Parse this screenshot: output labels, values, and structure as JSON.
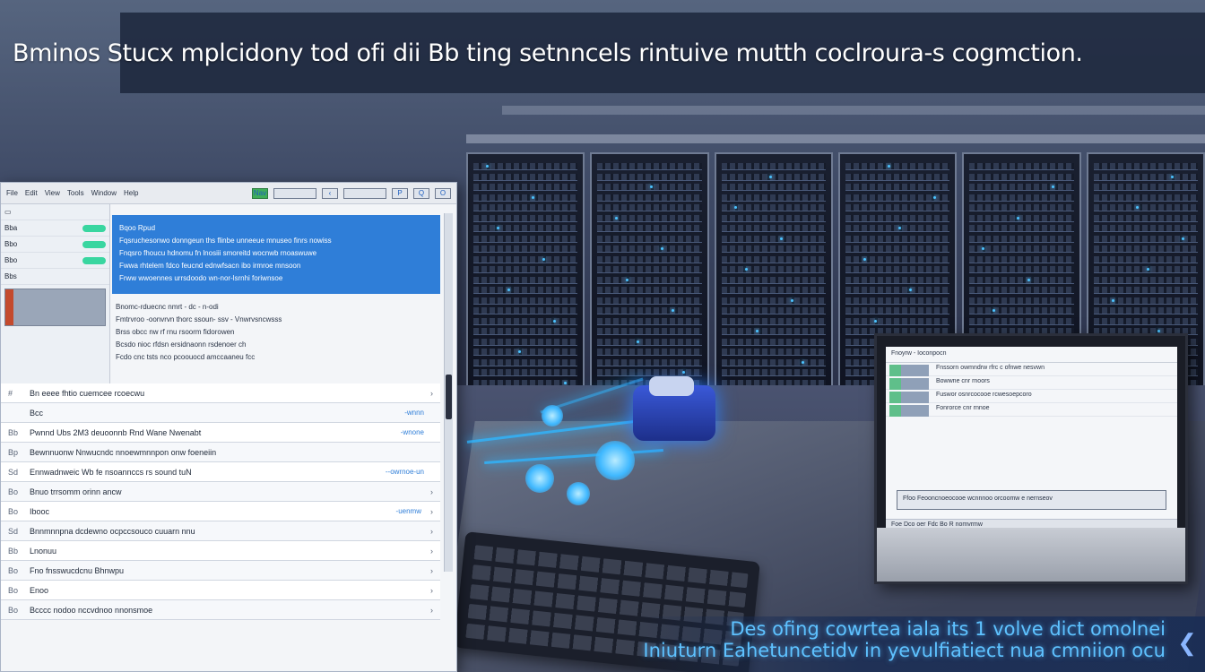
{
  "headline": "Bminos Stucx mplcidony tod ofi dii Bb ting setnncels rintuive mutth coclroura-s cogmction.",
  "caption": {
    "line1": "Des ofing cowrtea iala its 1 volve dict omolnei",
    "line2": "Iniuturn Eahetuncetidv in yevulfiatiect nua cmniion ocu"
  },
  "app_window": {
    "menubar": [
      "File",
      "Edit",
      "View",
      "Tools",
      "Window",
      "Help"
    ],
    "toolbar": {
      "nav_label": "Nav",
      "back_label": "‹",
      "search_label": "Q",
      "p_label": "P",
      "o_label": "O",
      "blank_label": ""
    },
    "leftnav": {
      "items": [
        {
          "label": "Bba"
        },
        {
          "label": "Bbo"
        },
        {
          "label": "Bbo"
        },
        {
          "label": "Bbs"
        }
      ]
    },
    "blue_panel": {
      "title": "Bqoo Rpud",
      "lines": [
        "Fqsruchesonwo donngeun ths flinbe unneeue mnuseo finrs nowiss",
        "Fnqsro fhoucu hdnomu fn lnosiii smoreitd wocnwb rnoaswuwe",
        "Fwwa rhtelem fdco feucnd ednwfsacn ibo irmroe mnsoon",
        "Frww wwoennes urrsdoodo wn-nor-lsrnhi foriwnsoe"
      ]
    },
    "info_lines": [
      "Bnomc-rduecnc nmrt - dc  -  n-odi",
      "Fmtrvroo -oonvrvn thorc ssoun- ssv - Vnwrvsncwsss",
      "Brss obcc nw rf  rnu rsoorm fidorowen",
      "Bcsdo nioc rfdsn ersidnaonn rsdenoer ch",
      "Fcdo cnc  tsts nco  pcoouocd amccaaneu fcc"
    ],
    "list": [
      {
        "mark": "#",
        "text": "Bn eeee fhtio cuemcee rcoecwu",
        "tag": "",
        "chev": "›"
      },
      {
        "mark": "",
        "text": "Bcc",
        "tag": "-wnnn",
        "chev": ""
      },
      {
        "mark": "Bb",
        "text": "Pwnnd Ubs 2M3 deuoonnb Rnd Wane Nwenabt",
        "tag": "-wnone",
        "chev": ""
      },
      {
        "mark": "Bp",
        "text": "Bewnnuonw Nnwucndc nnoewmnnpon onw foeneiin",
        "tag": "",
        "chev": ""
      },
      {
        "mark": "Sd",
        "text": "Ennwadnweic  Wb fe nsoannccs rs sound tuN",
        "tag": "--owrnoe-un",
        "chev": ""
      },
      {
        "mark": "Bo",
        "text": "Bnuo trrsomm orinn ancw",
        "tag": "",
        "chev": "›"
      },
      {
        "mark": "Bo",
        "text": "Ibooc",
        "tag": "-uenmw",
        "chev": "›"
      },
      {
        "mark": "Sd",
        "text": "Bnnmnnpna dcdewno ocpccsouco cuuarn nnu",
        "tag": "",
        "chev": "›"
      },
      {
        "mark": "Bb",
        "text": "Lnonuu",
        "tag": "",
        "chev": "›"
      },
      {
        "mark": "Bo",
        "text": "Fno fnsswucdcnu Bhnwpu",
        "tag": "",
        "chev": "›"
      },
      {
        "mark": "Bo",
        "text": "Enoo",
        "tag": "",
        "chev": "›"
      },
      {
        "mark": "Bo",
        "text": "Bcccc  nodoo nccvdnoo nnonsmoe",
        "tag": "",
        "chev": "›"
      }
    ]
  },
  "monitor": {
    "header": "Fnoyrw - Ioconpocn",
    "rows": [
      "Fnssorn owmndrw rfrc c ofnwe nesvwn",
      "Bowwne cnr rnoors",
      "Fuswor osnrcocooe rcwesoepcoro",
      "Fonrorce cnr rnnoe"
    ],
    "bar_text": "Ffoo Feooncnoeocooe wcnnnoo orcoomw e nernseov",
    "status_text": "Foe  Dco  oer  Fdc  Bo  R  nomvrmw"
  },
  "colors": {
    "accent_blue": "#2f7ed8",
    "glow": "#2fb6ff",
    "nav_pill": "#39d6a0"
  }
}
